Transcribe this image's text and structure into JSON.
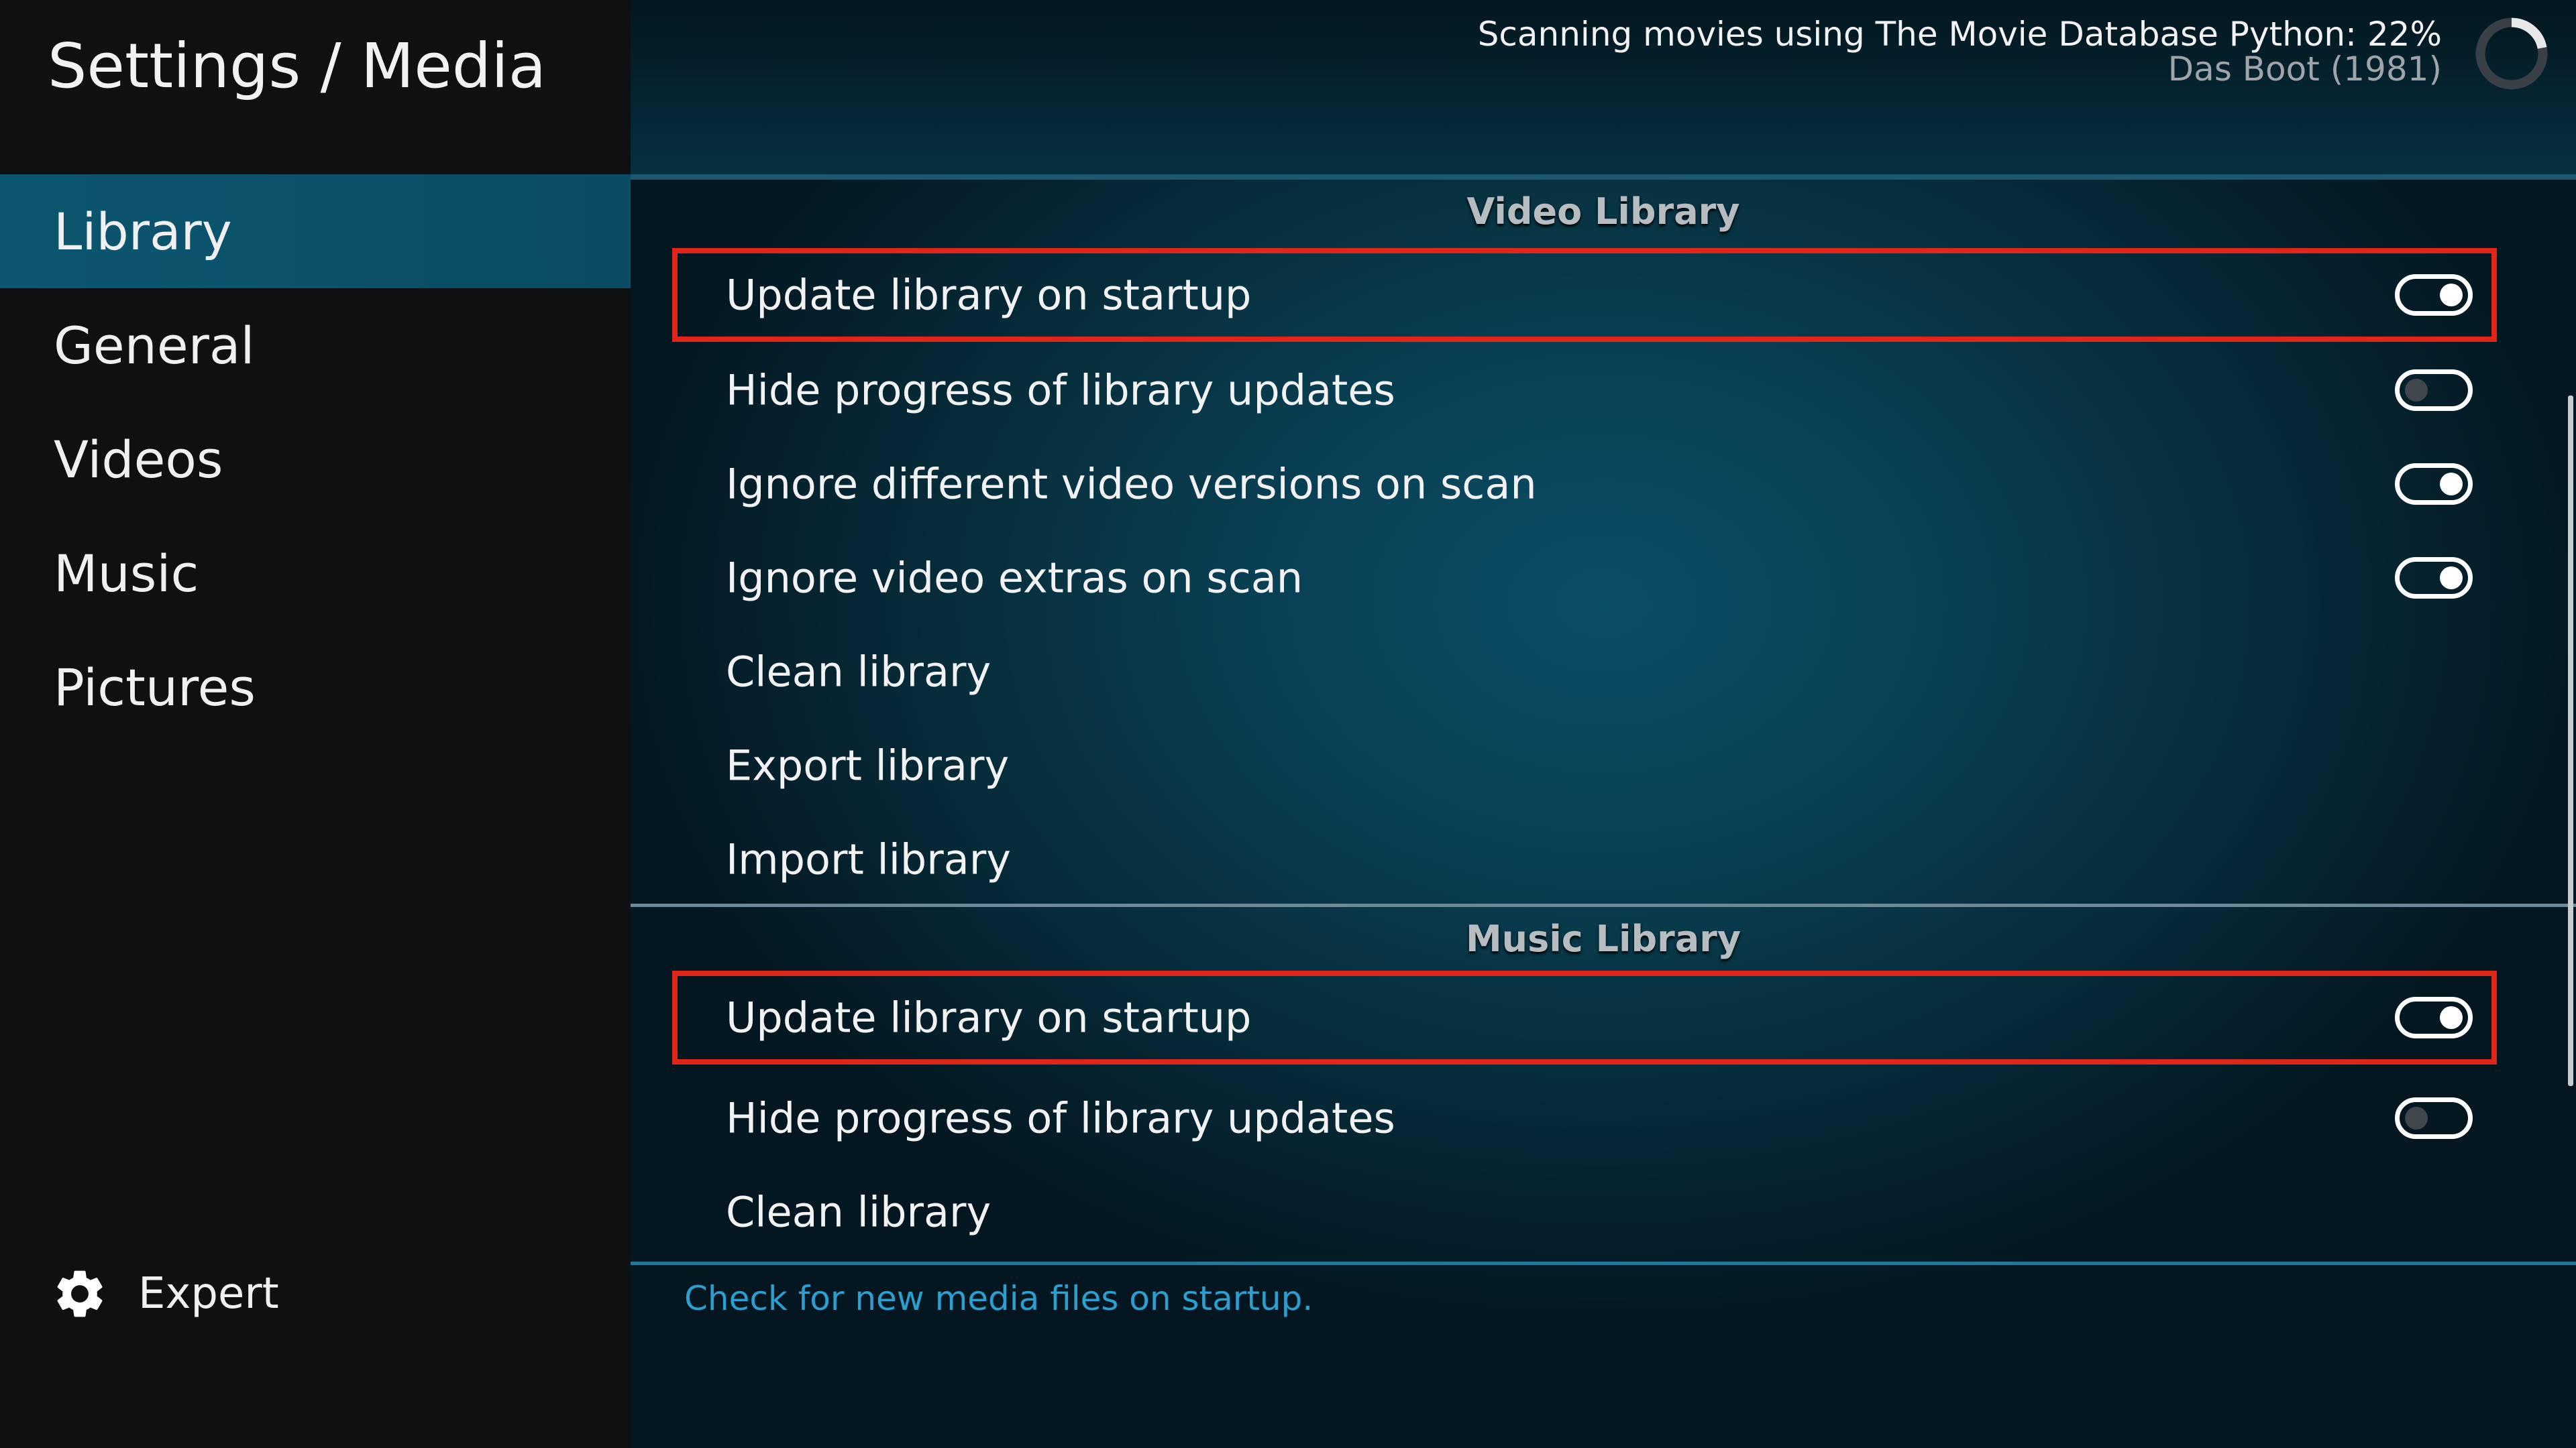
{
  "page_title": "Settings / Media",
  "sidebar": {
    "items": [
      {
        "label": "Library",
        "active": true
      },
      {
        "label": "General",
        "active": false
      },
      {
        "label": "Videos",
        "active": false
      },
      {
        "label": "Music",
        "active": false
      },
      {
        "label": "Pictures",
        "active": false
      }
    ],
    "expert": {
      "icon": "gear-icon",
      "label": "Expert"
    }
  },
  "status": {
    "message": "Scanning movies using The Movie Database Python: 22%",
    "item": "Das Boot (1981)",
    "progress_percent": 22
  },
  "video_library": {
    "heading": "Video Library",
    "settings": [
      {
        "label": "Update library on startup",
        "toggle": true,
        "highlighted": true
      },
      {
        "label": "Hide progress of library updates",
        "toggle": false
      },
      {
        "label": "Ignore different video versions on scan",
        "toggle": true
      },
      {
        "label": "Ignore video extras on scan",
        "toggle": true
      },
      {
        "label": "Clean library"
      },
      {
        "label": "Export library"
      },
      {
        "label": "Import library"
      }
    ]
  },
  "music_library": {
    "heading": "Music Library",
    "settings": [
      {
        "label": "Update library on startup",
        "toggle": true,
        "highlighted": true
      },
      {
        "label": "Hide progress of library updates",
        "toggle": false
      },
      {
        "label": "Clean library"
      }
    ]
  },
  "help_text": "Check for new media files on startup.",
  "colors": {
    "accent": "#0c5670",
    "highlight_border": "#e0261a",
    "help_text": "#2a9fd0"
  }
}
